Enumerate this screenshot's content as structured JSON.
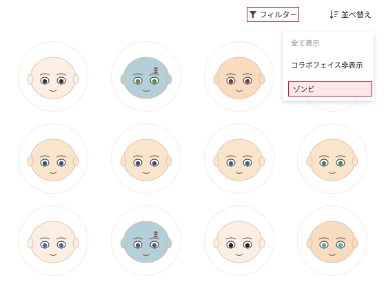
{
  "toolbar": {
    "filter_label": "フィルター",
    "sort_label": "並べ替え",
    "filter_icon": "funnel-icon",
    "sort_icon": "sort-icon"
  },
  "filter_menu": {
    "items": [
      {
        "label": "全て表示",
        "state": "muted"
      },
      {
        "label": "コラボフェイス非表示",
        "state": "normal"
      },
      {
        "label": "ゾンビ",
        "state": "selected"
      }
    ]
  },
  "faces": [
    {
      "name": "face-scarred-wink",
      "skin": "#fbefe3"
    },
    {
      "name": "face-zombie-blue",
      "skin": "#b3cfd8"
    },
    {
      "name": "face-mustache",
      "skin": "#f7dcc0"
    },
    {
      "name": "face-hidden",
      "skin": "#f7e2cc"
    },
    {
      "name": "face-blue-eyes-calm",
      "skin": "#f9e4cc"
    },
    {
      "name": "face-frown",
      "skin": "#f9e4cc"
    },
    {
      "name": "face-wink-smile",
      "skin": "#f9e4cc"
    },
    {
      "name": "face-green-eye",
      "skin": "#f9e4cc"
    },
    {
      "name": "face-bruised",
      "skin": "#fbefe3"
    },
    {
      "name": "face-zombie-stitched",
      "skin": "#b3cfd8"
    },
    {
      "name": "face-dark-eyes",
      "skin": "#fbefe3"
    },
    {
      "name": "face-cyan-eyes",
      "skin": "#f7dcc0"
    }
  ],
  "colors": {
    "accent": "#c8102e",
    "selected_bg": "#fde8ea"
  }
}
